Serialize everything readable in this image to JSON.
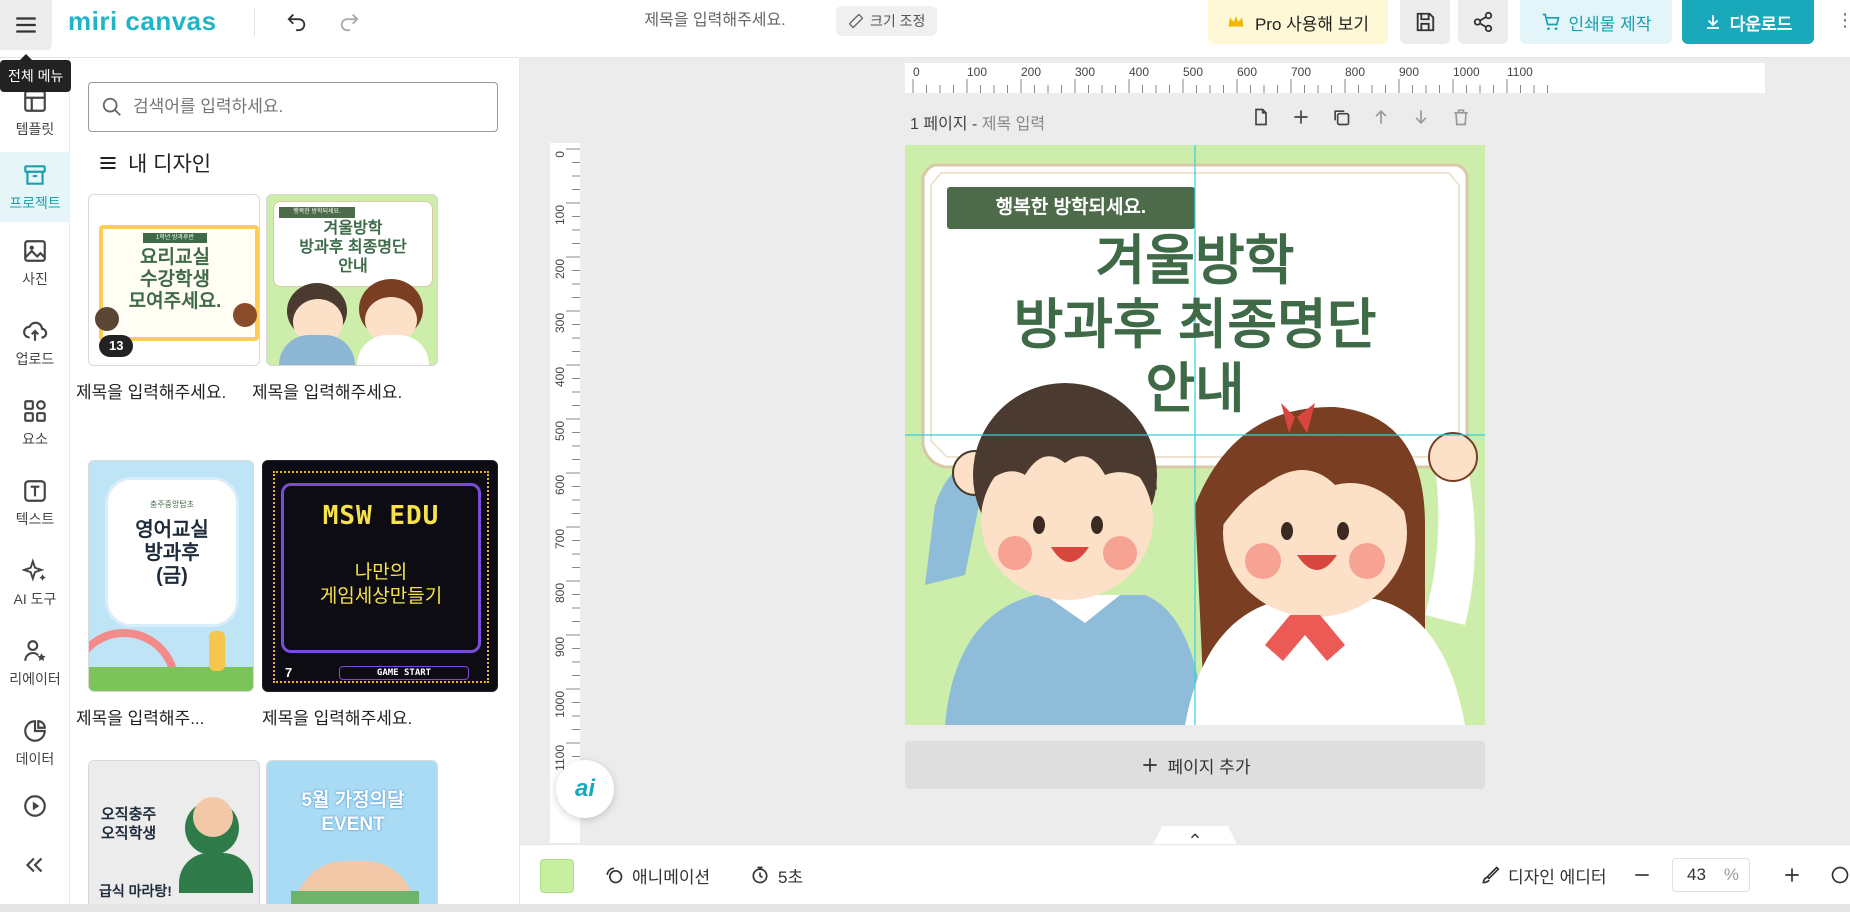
{
  "topbar": {
    "logo": "miri canvas",
    "title_placeholder": "제목을 입력해주세요.",
    "resize_label": "크기 조정",
    "pro_label": "Pro 사용해 보기",
    "print_label": "인쇄물 제작",
    "download_label": "다운로드",
    "menu_tooltip": "전체 메뉴"
  },
  "leftnav": {
    "items": [
      {
        "label": "템플릿"
      },
      {
        "label": "프로젝트"
      },
      {
        "label": "사진"
      },
      {
        "label": "업로드"
      },
      {
        "label": "요소"
      },
      {
        "label": "텍스트"
      },
      {
        "label": "AI 도구"
      },
      {
        "label": "리에이터"
      },
      {
        "label": "데이터"
      }
    ]
  },
  "panel": {
    "search_placeholder": "검색어를 입력하세요.",
    "section_title": "내 디자인",
    "designs": [
      {
        "title": "제목을 입력해주세요.",
        "count": "13",
        "lines": [
          "요리교실",
          "수강학생",
          "모여주세요."
        ],
        "tag": "1학년 방과후반"
      },
      {
        "title": "제목을 입력해주세요.",
        "lines": [
          "겨울방학",
          "방과후 최종명단",
          "안내"
        ],
        "tag": "행복한 방학되세요."
      },
      {
        "title": "제목을 입력해주...",
        "lines": [
          "영어교실",
          "방과후",
          "(금)"
        ],
        "tag": "충주중앙탑초"
      },
      {
        "title": "제목을 입력해주세요.",
        "count": "7",
        "lines": [
          "MSW EDU",
          "나만의",
          "게임세상만들기"
        ],
        "tag": "GAME START"
      },
      {
        "title": "",
        "lines": [
          "오직충주",
          "오직학생"
        ],
        "tag": "급식 마라탕!"
      },
      {
        "title": "",
        "lines": [
          "5월 가정의달",
          "EVENT"
        ],
        "tag": ""
      }
    ]
  },
  "canvas": {
    "page_label": "1 페이지",
    "page_sub": "제목 입력",
    "banner": "행복한 방학되세요.",
    "heading_lines": [
      "겨울방학",
      "방과후 최종명단",
      "안내"
    ],
    "add_page_label": "페이지 추가",
    "ai_label": "ai",
    "ruler_top": [
      "0",
      "100",
      "200",
      "300",
      "400",
      "500",
      "600",
      "700",
      "800",
      "900",
      "1000",
      "1100"
    ],
    "ruler_left": [
      "0",
      "100",
      "200",
      "300",
      "400",
      "500",
      "600",
      "700",
      "800",
      "900",
      "1000",
      "1100"
    ]
  },
  "bottombar": {
    "animation_label": "애니메이션",
    "duration_label": "5초",
    "design_editor_label": "디자인 에디터",
    "zoom_value": "43",
    "zoom_unit": "%"
  },
  "colors": {
    "accent": "#1aa8bb",
    "canvas_bg": "#cdeeaa",
    "heading": "#3f6a48",
    "banner_bg": "#4d6b4a"
  }
}
